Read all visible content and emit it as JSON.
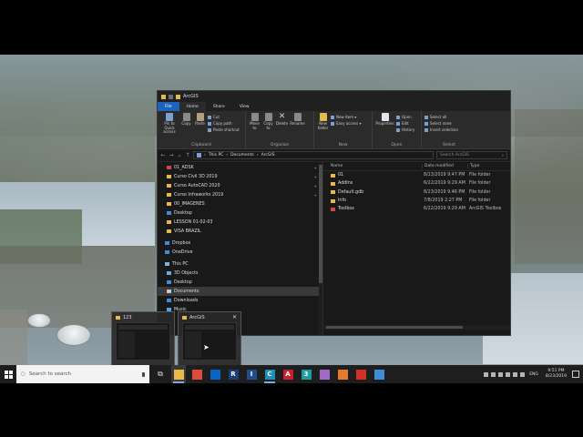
{
  "explorer": {
    "title": "ArcGIS",
    "tabs": [
      "File",
      "Home",
      "Share",
      "View"
    ],
    "ribbon": {
      "clipboard": {
        "group": "Clipboard",
        "pin": "Pin to Quick access",
        "copy": "Copy",
        "paste": "Paste",
        "cut": "Cut",
        "copy_path": "Copy path",
        "paste_shortcut": "Paste shortcut"
      },
      "organize": {
        "group": "Organize",
        "move_to": "Move to",
        "copy_to": "Copy to",
        "delete": "Delete",
        "rename": "Rename"
      },
      "new": {
        "group": "New",
        "new_folder": "New folder",
        "new_item": "New item ▾",
        "easy_access": "Easy access ▾"
      },
      "open": {
        "group": "Open",
        "properties": "Properties",
        "open": "Open",
        "edit": "Edit",
        "history": "History"
      },
      "select": {
        "group": "Select",
        "select_all": "Select all",
        "select_none": "Select none",
        "invert": "Invert selection"
      }
    },
    "address": {
      "crumbs": [
        "This PC",
        "Documents",
        "ArcGIS"
      ],
      "search_placeholder": "Search ArcGIS"
    },
    "nav": [
      {
        "label": "01_ADSK",
        "pinned": true
      },
      {
        "label": "Curso Civil 3D 2019",
        "pinned": true
      },
      {
        "label": "Curso AutoCAD 2020",
        "pinned": true
      },
      {
        "label": "Curso Infraworks 2019",
        "pinned": true
      },
      {
        "label": "00_IMAGENES",
        "pinned": false
      },
      {
        "label": "Desktop",
        "pinned": false
      },
      {
        "label": "LESSON 01-02-03",
        "pinned": false
      },
      {
        "label": "VISA BRAZIL",
        "pinned": false
      },
      {
        "label": "Dropbox",
        "pinned": false
      },
      {
        "label": "OneDrive",
        "pinned": false
      },
      {
        "label": "This PC",
        "pinned": false
      },
      {
        "label": "3D Objects",
        "pinned": false
      },
      {
        "label": "Desktop",
        "pinned": false
      },
      {
        "label": "Documents",
        "pinned": false
      },
      {
        "label": "Downloads",
        "pinned": false
      },
      {
        "label": "Music",
        "pinned": false
      }
    ],
    "columns": {
      "name": "Name",
      "date": "Date modified",
      "type": "Type"
    },
    "files": [
      {
        "name": "01",
        "date": "8/23/2019 9:47 PM",
        "type": "File folder"
      },
      {
        "name": "AddIns",
        "date": "6/22/2019 9:29 AM",
        "type": "File folder"
      },
      {
        "name": "Default.gdb",
        "date": "8/23/2019 9:46 PM",
        "type": "File folder"
      },
      {
        "name": "Info",
        "date": "7/8/2019 2:27 PM",
        "type": "File folder"
      },
      {
        "name": "Toolbox",
        "date": "6/22/2019 9:29 AM",
        "type": "ArcGIS Toolbox"
      }
    ]
  },
  "thumbnails": [
    {
      "title": "123"
    },
    {
      "title": "ArcGIS",
      "close": "✕"
    }
  ],
  "taskbar": {
    "search_placeholder": "Search to search",
    "apps": [
      {
        "icon": "explorer-icon",
        "glyph": "",
        "color": "#e8b84a"
      },
      {
        "icon": "chrome-icon",
        "glyph": "",
        "color": "#dd4b39"
      },
      {
        "icon": "outlook-icon",
        "glyph": "",
        "color": "#0a64c8"
      },
      {
        "icon": "revit-icon",
        "glyph": "R",
        "color": "#1a3e7a"
      },
      {
        "icon": "infraworks-icon",
        "glyph": "I",
        "color": "#224c8a"
      },
      {
        "icon": "civil3d-icon",
        "glyph": "C",
        "color": "#1e8fb8"
      },
      {
        "icon": "autocad-icon",
        "glyph": "A",
        "color": "#c8202c"
      },
      {
        "icon": "3dsmax-icon",
        "glyph": "3",
        "color": "#1a9e9e"
      },
      {
        "icon": "app-icon",
        "glyph": "",
        "color": "#a06bc6"
      },
      {
        "icon": "paint-icon",
        "glyph": "",
        "color": "#e57a28"
      },
      {
        "icon": "recorder-icon",
        "glyph": "",
        "color": "#d22f27"
      },
      {
        "icon": "arcgis-icon",
        "glyph": "",
        "color": "#3c8dd6"
      }
    ],
    "lang": "ENG",
    "time": "9:51 PM",
    "date": "8/23/2019"
  }
}
